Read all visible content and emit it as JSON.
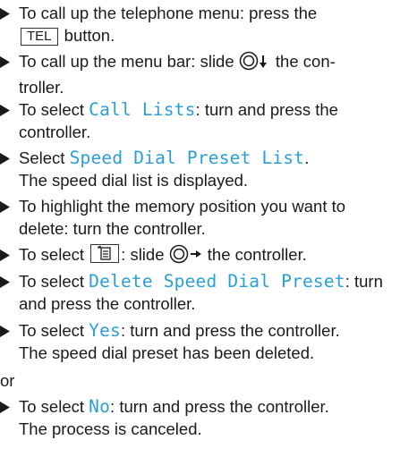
{
  "steps": [
    {
      "pre": "To call up the telephone menu: press the",
      "key": "TEL",
      "post": "button."
    },
    {
      "line1_pre": "To call up the menu bar: slide",
      "line1_post": "the con-",
      "line2": "troller."
    },
    {
      "pre": "To select",
      "code": "Call Lists",
      "post": ": turn and press the",
      "line2": "controller."
    },
    {
      "pre": "Select",
      "code": "Speed Dial Preset List",
      "post": ".",
      "result": "The speed dial list is displayed."
    },
    {
      "line1": "To highlight the memory position you want to",
      "line2": "delete: turn the controller."
    },
    {
      "pre": "To select",
      "post_icon": ":",
      "slide": "slide",
      "post": "the controller."
    },
    {
      "pre": "To select",
      "code": "Delete Speed Dial Preset",
      "post": ": turn",
      "line2": "and press the controller."
    },
    {
      "pre": "To select",
      "code": "Yes",
      "post": ": turn and press the controller.",
      "result": "The speed dial preset has been deleted."
    },
    {
      "pre": "To select",
      "code": "No",
      "post": ": turn and press the controller.",
      "result": "The process is canceled."
    }
  ],
  "or_text": "or",
  "colors": {
    "accent": "#2a9fd6",
    "text": "#1a1a1a"
  },
  "icons": [
    "arrow-bullet-icon",
    "controller-slide-down-icon",
    "controller-slide-right-icon",
    "menu-option-icon"
  ]
}
